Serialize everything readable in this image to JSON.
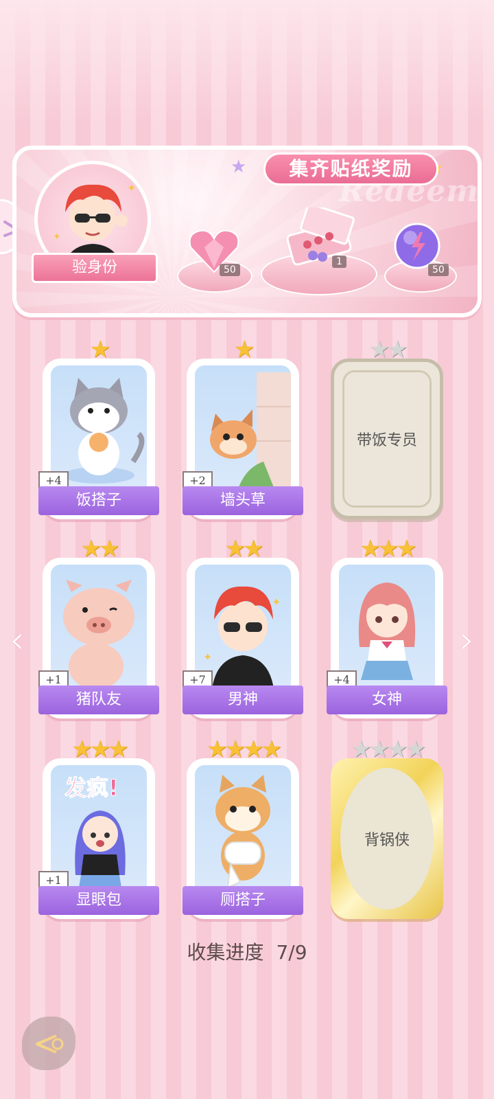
{
  "banner": {
    "title": "集齐贴纸奖励",
    "watermark": "Redeem",
    "verify_label": "验身份",
    "rewards": [
      {
        "icon": "heart-gem-icon",
        "count": "50"
      },
      {
        "icon": "gift-box-icon",
        "count": "1"
      },
      {
        "icon": "energy-orb-icon",
        "count": "50"
      }
    ]
  },
  "cards": [
    {
      "name": "饭搭子",
      "stars": 1,
      "count": "+4",
      "collected": true
    },
    {
      "name": "墙头草",
      "stars": 1,
      "count": "+2",
      "collected": true
    },
    {
      "name": "带饭专员",
      "stars": 2,
      "count": "",
      "collected": false
    },
    {
      "name": "猪队友",
      "stars": 2,
      "count": "+1",
      "collected": true
    },
    {
      "name": "男神",
      "stars": 2,
      "count": "+7",
      "collected": true
    },
    {
      "name": "女神",
      "stars": 3,
      "count": "+4",
      "collected": true
    },
    {
      "name": "显眼包",
      "stars": 3,
      "count": "+1",
      "collected": true
    },
    {
      "name": "厕搭子",
      "stars": 4,
      "count": "",
      "collected": true
    },
    {
      "name": "背锅侠",
      "stars": 4,
      "count": "",
      "collected": false
    }
  ],
  "stickers": {
    "fafeng": "发疯!"
  },
  "progress": {
    "label": "收集进度",
    "value": "7/9"
  },
  "colors": {
    "accent": "#ea6d93",
    "label_purple": "#9b63de",
    "star_gold": "#f8c137"
  }
}
